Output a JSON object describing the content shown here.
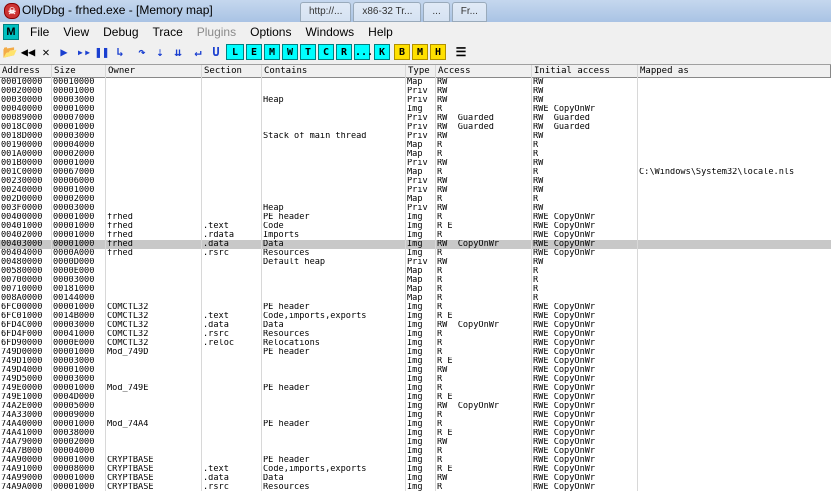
{
  "window": {
    "title": "OllyDbg - frhed.exe - [Memory map]",
    "icon_letter": "☠",
    "background_tabs": [
      "http://...",
      "x86-32 Tr...",
      "...",
      "Fr..."
    ]
  },
  "menubar": {
    "m_icon_letter": "M",
    "items": [
      {
        "label": "File",
        "disabled": false
      },
      {
        "label": "View",
        "disabled": false
      },
      {
        "label": "Debug",
        "disabled": false
      },
      {
        "label": "Trace",
        "disabled": false
      },
      {
        "label": "Plugins",
        "disabled": true
      },
      {
        "label": "Options",
        "disabled": false
      },
      {
        "label": "Windows",
        "disabled": false
      },
      {
        "label": "Help",
        "disabled": false
      }
    ]
  },
  "toolbar": {
    "buttons": [
      {
        "name": "open-icon",
        "glyph": "📂",
        "style": "icon black"
      },
      {
        "name": "restart-icon",
        "glyph": "◀◀",
        "style": "icon black"
      },
      {
        "name": "close-icon",
        "glyph": "✕",
        "style": "icon black"
      },
      {
        "name": "run-icon",
        "glyph": "▶",
        "style": "icon"
      },
      {
        "name": "run-thread-icon",
        "glyph": "▸▸",
        "style": "icon"
      },
      {
        "name": "pause-icon",
        "glyph": "❚❚",
        "style": "icon"
      },
      {
        "name": "step-into-icon",
        "glyph": "↳",
        "style": "icon"
      },
      {
        "name": "step-over-icon",
        "glyph": "↷",
        "style": "icon"
      },
      {
        "name": "trace-into-icon",
        "glyph": "⇣",
        "style": "icon"
      },
      {
        "name": "trace-over-icon",
        "glyph": "⇊",
        "style": "icon"
      },
      {
        "name": "execute-till-return-icon",
        "glyph": "↵",
        "style": "icon"
      },
      {
        "name": "execute-till-user-icon",
        "glyph": "U",
        "style": "icon"
      },
      {
        "name": "log-button",
        "glyph": "L",
        "style": "cyan"
      },
      {
        "name": "modules-button",
        "glyph": "E",
        "style": "cyan"
      },
      {
        "name": "memory-button",
        "glyph": "M",
        "style": "cyan"
      },
      {
        "name": "windows-button",
        "glyph": "W",
        "style": "cyan"
      },
      {
        "name": "threads-button",
        "glyph": "T",
        "style": "cyan"
      },
      {
        "name": "cpu-button",
        "glyph": "C",
        "style": "cyan"
      },
      {
        "name": "references-button",
        "glyph": "R",
        "style": "cyan"
      },
      {
        "name": "run-trace-button",
        "glyph": "...",
        "style": "cyan"
      },
      {
        "name": "patches-button",
        "glyph": "K",
        "style": "cyan"
      },
      {
        "name": "breakpoints-button",
        "glyph": "B",
        "style": "yellow"
      },
      {
        "name": "memory-breakpoints-button",
        "glyph": "M",
        "style": "yellow"
      },
      {
        "name": "hardware-breakpoints-button",
        "glyph": "H",
        "style": "yellow"
      },
      {
        "name": "options-list-icon",
        "glyph": "☰",
        "style": "icon black"
      }
    ]
  },
  "table": {
    "columns": [
      "Address",
      "Size",
      "Owner",
      "Section",
      "Contains",
      "Type",
      "Access",
      "Initial access",
      "Mapped as"
    ],
    "selected_row": 18,
    "rows": [
      [
        "00010000",
        "00010000",
        "",
        "",
        "",
        "Map",
        "RW",
        "RW",
        ""
      ],
      [
        "00020000",
        "00001000",
        "",
        "",
        "",
        "Priv",
        "RW",
        "RW",
        ""
      ],
      [
        "00030000",
        "00003000",
        "",
        "",
        "Heap",
        "Priv",
        "RW",
        "RW",
        ""
      ],
      [
        "00040000",
        "00001000",
        "",
        "",
        "",
        "Img",
        "R",
        "RWE CopyOnWr",
        ""
      ],
      [
        "00089000",
        "00007000",
        "",
        "",
        "",
        "Priv",
        "RW  Guarded",
        "RW  Guarded",
        ""
      ],
      [
        "0018C000",
        "00001000",
        "",
        "",
        "",
        "Priv",
        "RW  Guarded",
        "RW  Guarded",
        ""
      ],
      [
        "0018D000",
        "00003000",
        "",
        "",
        "Stack of main thread",
        "Priv",
        "RW",
        "RW",
        ""
      ],
      [
        "00190000",
        "00004000",
        "",
        "",
        "",
        "Map",
        "R",
        "R",
        ""
      ],
      [
        "001A0000",
        "00002000",
        "",
        "",
        "",
        "Map",
        "R",
        "R",
        ""
      ],
      [
        "001B0000",
        "00001000",
        "",
        "",
        "",
        "Priv",
        "RW",
        "RW",
        ""
      ],
      [
        "001C0000",
        "00067000",
        "",
        "",
        "",
        "Map",
        "R",
        "R",
        "C:\\Windows\\System32\\locale.nls"
      ],
      [
        "00230000",
        "00006000",
        "",
        "",
        "",
        "Priv",
        "RW",
        "RW",
        ""
      ],
      [
        "00240000",
        "00001000",
        "",
        "",
        "",
        "Priv",
        "RW",
        "RW",
        ""
      ],
      [
        "002D0000",
        "00002000",
        "",
        "",
        "",
        "Map",
        "R",
        "R",
        ""
      ],
      [
        "003F0000",
        "00003000",
        "",
        "",
        "Heap",
        "Priv",
        "RW",
        "RW",
        ""
      ],
      [
        "00400000",
        "00001000",
        "frhed",
        "",
        "PE header",
        "Img",
        "R",
        "RWE CopyOnWr",
        ""
      ],
      [
        "00401000",
        "00001000",
        "frhed",
        ".text",
        "Code",
        "Img",
        "R E",
        "RWE CopyOnWr",
        ""
      ],
      [
        "00402000",
        "00001000",
        "frhed",
        ".rdata",
        "Imports",
        "Img",
        "R",
        "RWE CopyOnWr",
        ""
      ],
      [
        "00403000",
        "00001000",
        "frhed",
        ".data",
        "Data",
        "Img",
        "RW  CopyOnWr",
        "RWE CopyOnWr",
        ""
      ],
      [
        "00404000",
        "0000A000",
        "frhed",
        ".rsrc",
        "Resources",
        "Img",
        "R",
        "RWE CopyOnWr",
        ""
      ],
      [
        "00480000",
        "0000D000",
        "",
        "",
        "Default heap",
        "Priv",
        "RW",
        "RW",
        ""
      ],
      [
        "00580000",
        "0000E000",
        "",
        "",
        "",
        "Map",
        "R",
        "R",
        ""
      ],
      [
        "00700000",
        "00003000",
        "",
        "",
        "",
        "Map",
        "R",
        "R",
        ""
      ],
      [
        "00710000",
        "00181000",
        "",
        "",
        "",
        "Map",
        "R",
        "R",
        ""
      ],
      [
        "008A0000",
        "00144000",
        "",
        "",
        "",
        "Map",
        "R",
        "R",
        ""
      ],
      [
        "6FC00000",
        "00001000",
        "COMCTL32",
        "",
        "PE header",
        "Img",
        "R",
        "RWE CopyOnWr",
        ""
      ],
      [
        "6FC01000",
        "0014B000",
        "COMCTL32",
        ".text",
        "Code,imports,exports",
        "Img",
        "R E",
        "RWE CopyOnWr",
        ""
      ],
      [
        "6FD4C000",
        "00003000",
        "COMCTL32",
        ".data",
        "Data",
        "Img",
        "RW  CopyOnWr",
        "RWE CopyOnWr",
        ""
      ],
      [
        "6FD4F000",
        "00041000",
        "COMCTL32",
        ".rsrc",
        "Resources",
        "Img",
        "R",
        "RWE CopyOnWr",
        ""
      ],
      [
        "6FD90000",
        "0000E000",
        "COMCTL32",
        ".reloc",
        "Relocations",
        "Img",
        "R",
        "RWE CopyOnWr",
        ""
      ],
      [
        "749D0000",
        "00001000",
        "Mod_749D",
        "",
        "PE header",
        "Img",
        "R",
        "RWE CopyOnWr",
        ""
      ],
      [
        "749D1000",
        "00003000",
        "",
        "",
        "",
        "Img",
        "R E",
        "RWE CopyOnWr",
        ""
      ],
      [
        "749D4000",
        "00001000",
        "",
        "",
        "",
        "Img",
        "RW",
        "RWE CopyOnWr",
        ""
      ],
      [
        "749D5000",
        "00003000",
        "",
        "",
        "",
        "Img",
        "R",
        "RWE CopyOnWr",
        ""
      ],
      [
        "749E0000",
        "00001000",
        "Mod_749E",
        "",
        "PE header",
        "Img",
        "R",
        "RWE CopyOnWr",
        ""
      ],
      [
        "749E1000",
        "0004D000",
        "",
        "",
        "",
        "Img",
        "R E",
        "RWE CopyOnWr",
        ""
      ],
      [
        "74A2E000",
        "00005000",
        "",
        "",
        "",
        "Img",
        "RW  CopyOnWr",
        "RWE CopyOnWr",
        ""
      ],
      [
        "74A33000",
        "00009000",
        "",
        "",
        "",
        "Img",
        "R",
        "RWE CopyOnWr",
        ""
      ],
      [
        "74A40000",
        "00001000",
        "Mod_74A4",
        "",
        "PE header",
        "Img",
        "R",
        "RWE CopyOnWr",
        ""
      ],
      [
        "74A41000",
        "00038000",
        "",
        "",
        "",
        "Img",
        "R E",
        "RWE CopyOnWr",
        ""
      ],
      [
        "74A79000",
        "00002000",
        "",
        "",
        "",
        "Img",
        "RW",
        "RWE CopyOnWr",
        ""
      ],
      [
        "74A7B000",
        "00004000",
        "",
        "",
        "",
        "Img",
        "R",
        "RWE CopyOnWr",
        ""
      ],
      [
        "74A90000",
        "00001000",
        "CRYPTBASE",
        "",
        "PE header",
        "Img",
        "R",
        "RWE CopyOnWr",
        ""
      ],
      [
        "74A91000",
        "00008000",
        "CRYPTBASE",
        ".text",
        "Code,imports,exports",
        "Img",
        "R E",
        "RWE CopyOnWr",
        ""
      ],
      [
        "74A99000",
        "00001000",
        "CRYPTBASE",
        ".data",
        "Data",
        "Img",
        "RW",
        "RWE CopyOnWr",
        ""
      ],
      [
        "74A9A000",
        "00001000",
        "CRYPTBASE",
        ".rsrc",
        "Resources",
        "Img",
        "R",
        "RWE CopyOnWr",
        ""
      ]
    ]
  }
}
